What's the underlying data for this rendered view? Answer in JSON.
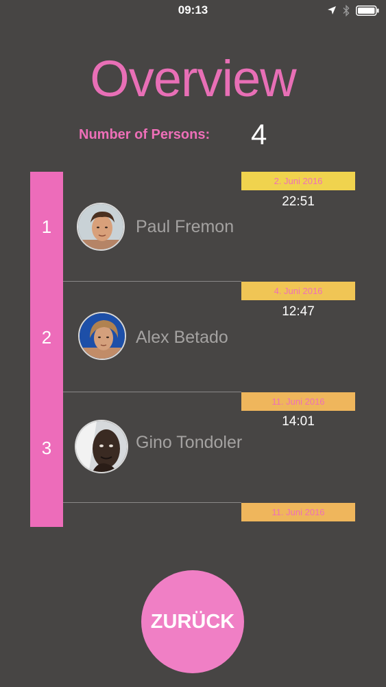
{
  "status_bar": {
    "time": "09:13",
    "icons": [
      "location-arrow-icon",
      "bluetooth-icon",
      "battery-icon"
    ]
  },
  "title": "Overview",
  "person_count": {
    "label": "Number of Persons:",
    "value": "4"
  },
  "entries": [
    {
      "number": "1",
      "name": "Paul Fremon",
      "date": "2. Juni 2016",
      "time": "22:51",
      "badge_color": "#f0d34e"
    },
    {
      "number": "2",
      "name": "Alex Betado",
      "date": "4. Juni 2016",
      "time": "12:47",
      "badge_color": "#f0c555"
    },
    {
      "number": "3",
      "name": "Gino Tondoler",
      "date": "11. Juni 2016",
      "time": "14:01",
      "badge_color": "#efb65c"
    },
    {
      "number": "",
      "name": "",
      "date": "11. Juni 2016",
      "time": "",
      "badge_color": "#efb65c"
    }
  ],
  "back_button": {
    "label": "ZURÜCK"
  },
  "colors": {
    "background": "#474544",
    "accent_pink": "#ed6cba",
    "button_pink": "#f07fc5"
  }
}
